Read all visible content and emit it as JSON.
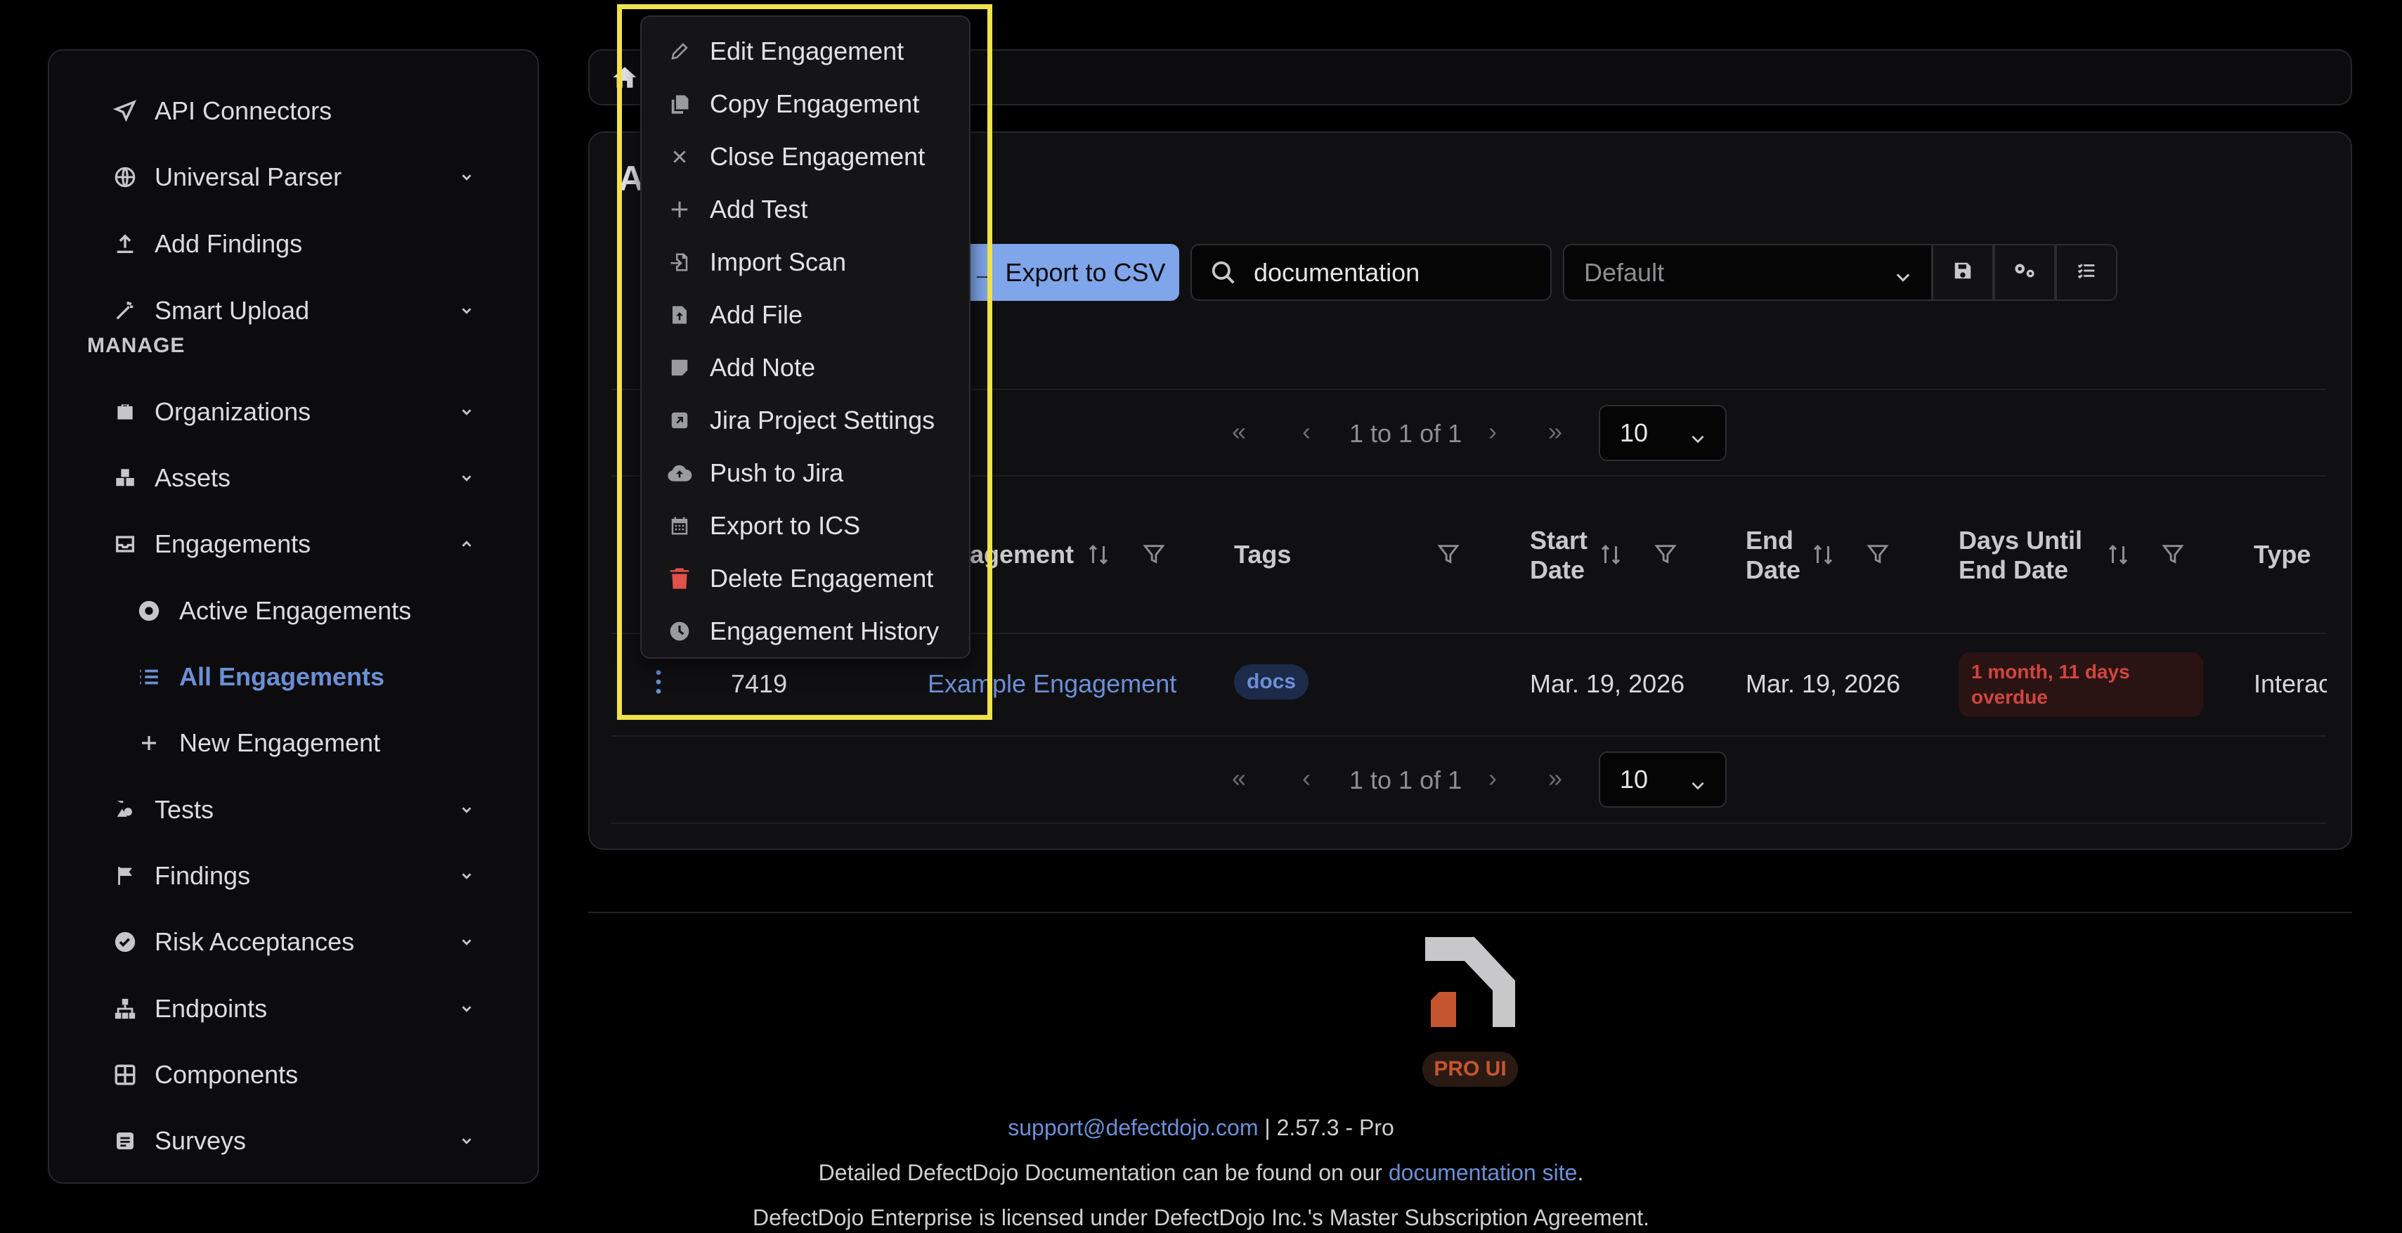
{
  "sidebar": {
    "items": [
      {
        "label": "API Connectors",
        "icon": "send-icon",
        "chevron": false
      },
      {
        "label": "Universal Parser",
        "icon": "globe-icon",
        "chevron": true
      },
      {
        "label": "Add Findings",
        "icon": "upload-icon",
        "chevron": false
      },
      {
        "label": "Smart Upload",
        "icon": "magic-wand-icon",
        "chevron": true
      }
    ],
    "manage_header": "MANAGE",
    "manage_items": [
      {
        "label": "Organizations",
        "icon": "briefcase-icon"
      },
      {
        "label": "Assets",
        "icon": "boxes-icon"
      },
      {
        "label": "Engagements",
        "icon": "inbox-icon"
      },
      {
        "label": "Active Engagements",
        "icon": "target-icon"
      },
      {
        "label": "All Engagements",
        "icon": "list-icon"
      },
      {
        "label": "New Engagement",
        "icon": "plus-icon"
      },
      {
        "label": "Tests",
        "icon": "flask-icon"
      },
      {
        "label": "Findings",
        "icon": "flag-icon"
      },
      {
        "label": "Risk Acceptances",
        "icon": "check-circle-icon"
      },
      {
        "label": "Endpoints",
        "icon": "sitemap-icon"
      },
      {
        "label": "Components",
        "icon": "grid-icon"
      },
      {
        "label": "Surveys",
        "icon": "survey-icon"
      }
    ]
  },
  "main": {
    "title_partial": "A",
    "toolbar": {
      "export_csv": "Export to CSV",
      "search_value": "documentation",
      "filter_select": "Default"
    },
    "pager": {
      "range_text": "1 to 1 of 1",
      "page_size": "10"
    },
    "table": {
      "columns": {
        "engagement": "agement",
        "tags": "Tags",
        "start_date": "Start Date",
        "end_date": "End Date",
        "days_until_end": "Days Until End Date",
        "type": "Type"
      },
      "row": {
        "id": "7419",
        "engagement": "Example Engagement",
        "tag": "docs",
        "start_date": "Mar. 19, 2026",
        "end_date": "Mar. 19, 2026",
        "days_until_end": "1 month, 11 days overdue",
        "type": "Interac"
      }
    }
  },
  "menu": {
    "items": [
      {
        "label": "Edit Engagement",
        "icon": "pencil-icon"
      },
      {
        "label": "Copy Engagement",
        "icon": "copy-icon"
      },
      {
        "label": "Close Engagement",
        "icon": "close-icon"
      },
      {
        "label": "Add Test",
        "icon": "plus-icon"
      },
      {
        "label": "Import Scan",
        "icon": "file-import-icon"
      },
      {
        "label": "Add File",
        "icon": "file-upload-icon"
      },
      {
        "label": "Add Note",
        "icon": "note-icon"
      },
      {
        "label": "Jira Project Settings",
        "icon": "external-link-icon"
      },
      {
        "label": "Push to Jira",
        "icon": "cloud-upload-icon"
      },
      {
        "label": "Export to ICS",
        "icon": "calendar-icon"
      },
      {
        "label": "Delete Engagement",
        "icon": "trash-icon"
      },
      {
        "label": "Engagement History",
        "icon": "clock-icon"
      }
    ]
  },
  "footer": {
    "badge": "PRO UI",
    "support_email": "support@defectdojo.com",
    "version": " | 2.57.3 - Pro",
    "docs_prefix": "Detailed DefectDojo Documentation can be found on our ",
    "docs_link": "documentation site",
    "docs_suffix": ".",
    "license": "DefectDojo Enterprise is licensed under DefectDojo Inc.'s Master Subscription Agreement."
  },
  "colors": {
    "accent": "#6c8fd6",
    "highlight": "#f1e24a",
    "danger": "#d0463f",
    "brand_orange": "#c4562f"
  }
}
